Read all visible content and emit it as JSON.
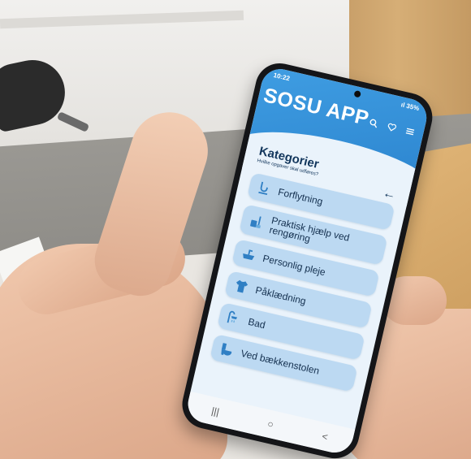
{
  "status_bar": {
    "time": "10:22",
    "right_status": "ıl 35%"
  },
  "app": {
    "title": "SOSU APP"
  },
  "header_icons": [
    "search-icon",
    "heart-icon",
    "menu-icon"
  ],
  "section": {
    "title": "Kategorier",
    "subtitle": "Hvilke opgaver skal udføres?"
  },
  "categories": [
    {
      "label": "Forflytning",
      "icon": "lift-icon"
    },
    {
      "label": "Praktisk hjælp ved rengøring",
      "icon": "cleaning-icon"
    },
    {
      "label": "Personlig pleje",
      "icon": "sink-icon"
    },
    {
      "label": "Påklædning",
      "icon": "shirt-icon"
    },
    {
      "label": "Bad",
      "icon": "shower-icon"
    },
    {
      "label": "Ved bækkenstolen",
      "icon": "toilet-icon"
    }
  ],
  "nav": {
    "recent": "|||",
    "home": "○",
    "back": "<"
  },
  "colors": {
    "header": "#3f9de2",
    "card": "#bcd9f2",
    "title": "#12365c"
  }
}
